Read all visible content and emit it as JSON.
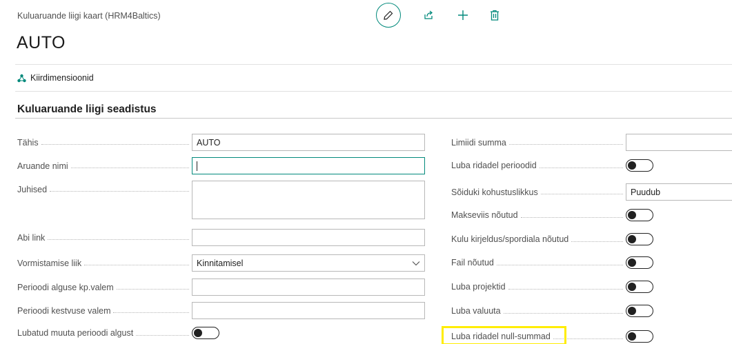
{
  "header": {
    "breadcrumb": "Kuluaruande liigi kaart (HRM4Baltics)",
    "title": "AUTO"
  },
  "toolbar": {
    "edit_icon": "pencil-icon",
    "share_icon": "share-icon",
    "new_icon": "plus-icon",
    "delete_icon": "trash-icon",
    "accent_color": "#00897b"
  },
  "actions": {
    "dimensions_label": "Kiirdimensioonid",
    "dimensions_icon": "dimensions-icon"
  },
  "section": {
    "title": "Kuluaruande liigi seadistus"
  },
  "left_fields": {
    "tahis": {
      "label": "Tähis",
      "value": "AUTO"
    },
    "aruande_nimi": {
      "label": "Aruande nimi",
      "value": ""
    },
    "juhised": {
      "label": "Juhised",
      "value": ""
    },
    "abi_link": {
      "label": "Abi link",
      "value": ""
    },
    "vormistamise_liik": {
      "label": "Vormistamise liik",
      "value": "Kinnitamisel"
    },
    "perioodi_algus": {
      "label": "Perioodi alguse kp.valem",
      "value": ""
    },
    "perioodi_kestus": {
      "label": "Perioodi kestvuse valem",
      "value": ""
    },
    "lubatud_muuta": {
      "label": "Lubatud muuta perioodi algust",
      "value": false
    }
  },
  "right_fields": {
    "limiidi_summa": {
      "label": "Limiidi summa",
      "value": ""
    },
    "luba_perioodid": {
      "label": "Luba ridadel perioodid",
      "value": false
    },
    "soiduki_kohustuslikkus": {
      "label": "Sõiduki kohustuslikkus",
      "value": "Puudub"
    },
    "makseviis": {
      "label": "Makseviis nõutud",
      "value": false
    },
    "kulu_kirjeldus": {
      "label": "Kulu kirjeldus/spordiala nõutud",
      "value": false
    },
    "fail": {
      "label": "Fail nõutud",
      "value": false
    },
    "projektid": {
      "label": "Luba projektid",
      "value": false
    },
    "valuuta": {
      "label": "Luba valuuta",
      "value": false
    },
    "null_summad": {
      "label": "Luba ridadel null-summad",
      "value": false
    }
  },
  "highlight_color": "#ffed00"
}
